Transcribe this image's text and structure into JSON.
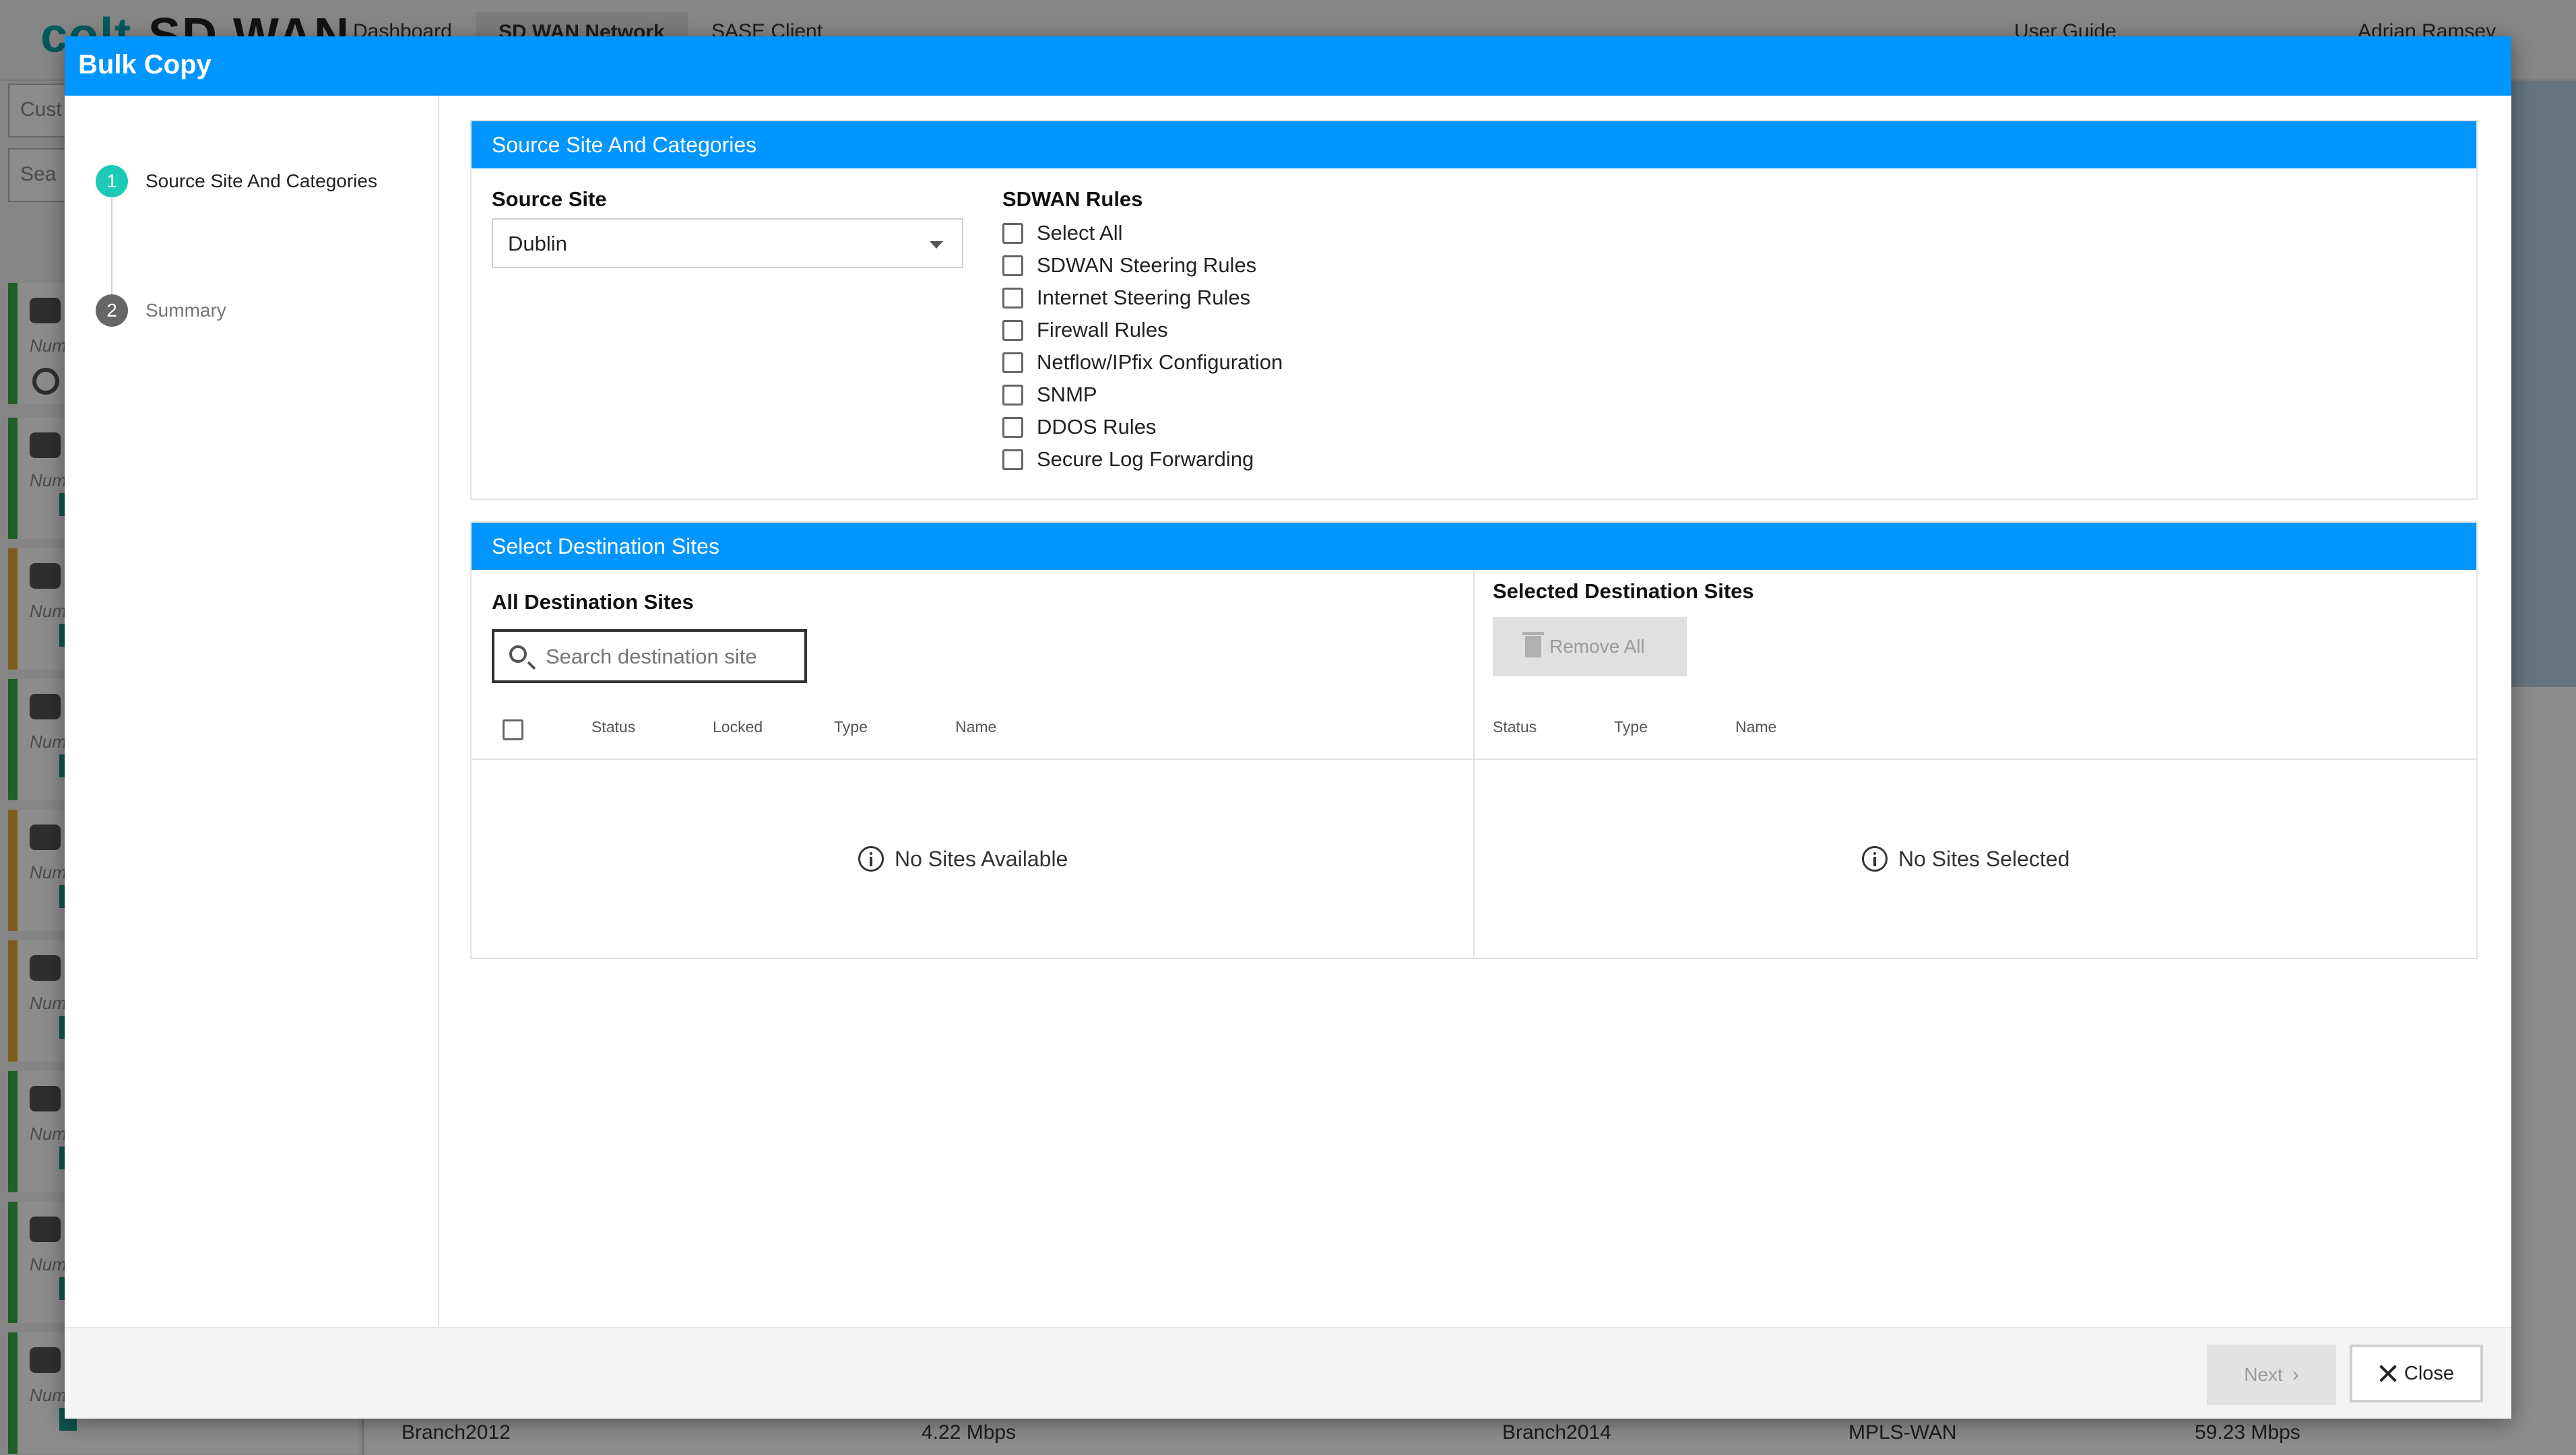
{
  "background": {
    "logo_brand": "colt",
    "logo_product": "SD WAN",
    "nav": [
      "Dashboard",
      "SD WAN Network",
      "SASE Client"
    ],
    "user_guide": "User Guide",
    "user_name": "Adrian Ramsey",
    "customer_input": "Cust",
    "search_input": "Sea",
    "card_label": "Numi",
    "bottom_row": {
      "left_name": "Branch2012",
      "left_rate": "4.22 Mbps",
      "right_name": "Branch2014",
      "right_type": "MPLS-WAN",
      "right_rate": "59.23 Mbps"
    }
  },
  "modal": {
    "title": "Bulk Copy",
    "steps": [
      {
        "number": "1",
        "label": "Source Site And Categories"
      },
      {
        "number": "2",
        "label": "Summary"
      }
    ],
    "source_panel": {
      "header": "Source Site And Categories",
      "source_site_label": "Source Site",
      "source_site_value": "Dublin",
      "rules_label": "SDWAN Rules",
      "rules": [
        "Select All",
        "SDWAN Steering Rules",
        "Internet Steering Rules",
        "Firewall Rules",
        "Netflow/IPfix Configuration",
        "SNMP",
        "DDOS Rules",
        "Secure Log Forwarding"
      ]
    },
    "destination_panel": {
      "header": "Select Destination Sites",
      "all_sites_label": "All Destination Sites",
      "search_placeholder": "Search destination site",
      "all_columns": [
        "Status",
        "Locked",
        "Type",
        "Name"
      ],
      "empty_all": "No Sites Available",
      "selected_sites_label": "Selected Destination Sites",
      "remove_all_label": "Remove All",
      "selected_columns": [
        "Status",
        "Type",
        "Name"
      ],
      "empty_selected": "No Sites Selected"
    },
    "footer": {
      "next_label": "Next",
      "close_label": "Close"
    }
  }
}
